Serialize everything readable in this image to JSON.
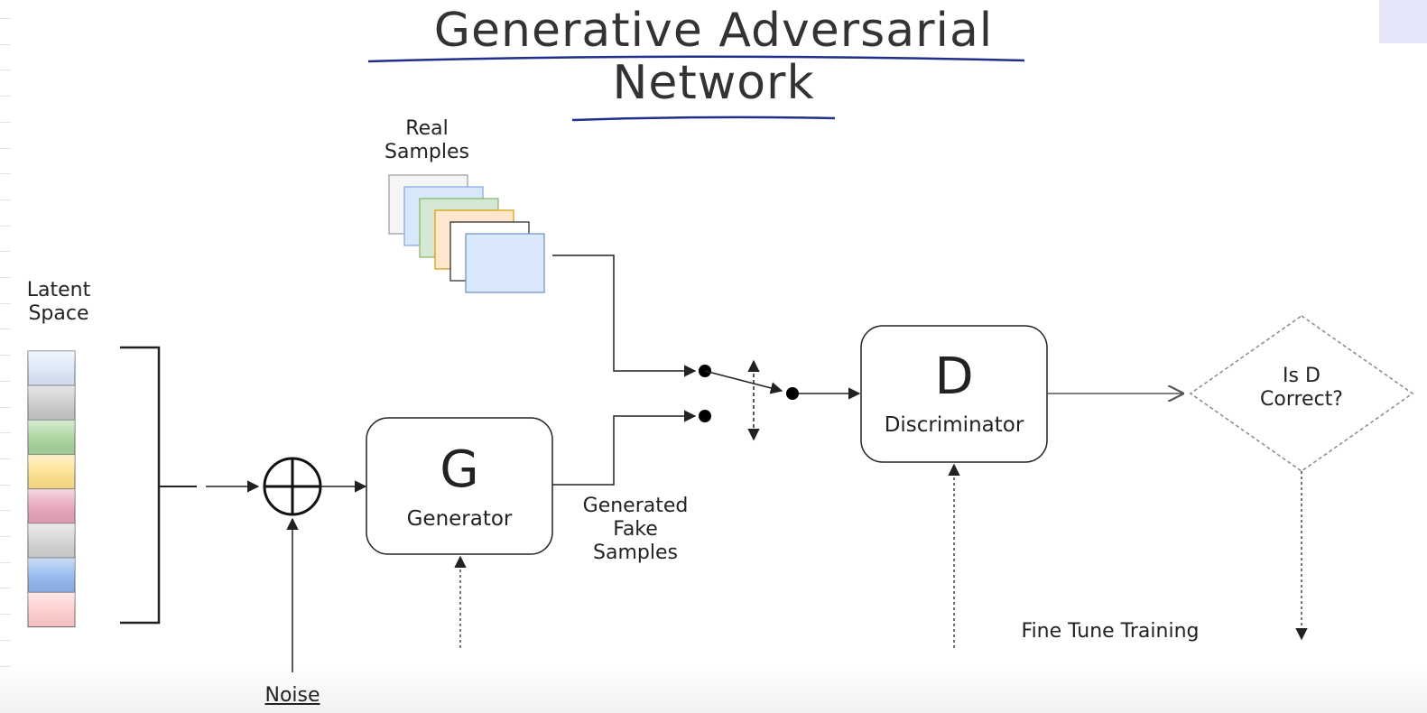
{
  "title": {
    "line1": "Generative Adversarial",
    "line2": "Network"
  },
  "labels": {
    "real_samples": "Real\nSamples",
    "latent_space": "Latent\nSpace",
    "generated_fake_samples": "Generated\nFake\nSamples",
    "noise": "Noise",
    "fine_tune_training": "Fine Tune Training",
    "decision": "Is D\nCorrect?"
  },
  "generator": {
    "letter": "G",
    "name": "Generator"
  },
  "discriminator": {
    "letter": "D",
    "name": "Discriminator"
  },
  "latent_colors": [
    "#dbe8f8",
    "#c9c9c9",
    "#a6d39a",
    "#ffe08a",
    "#e6a3bb",
    "#d2d2d2",
    "#8fb6ee",
    "#ffcccc"
  ],
  "real_sample_colors": [
    "#f5f5f5",
    "#dae8fc",
    "#d5e8d4",
    "#ffe6cc",
    "#ffffff",
    "#dae8fc"
  ],
  "colors": {
    "underline": "#1f2f8c",
    "stroke": "#222222",
    "dashed": "#777777"
  }
}
